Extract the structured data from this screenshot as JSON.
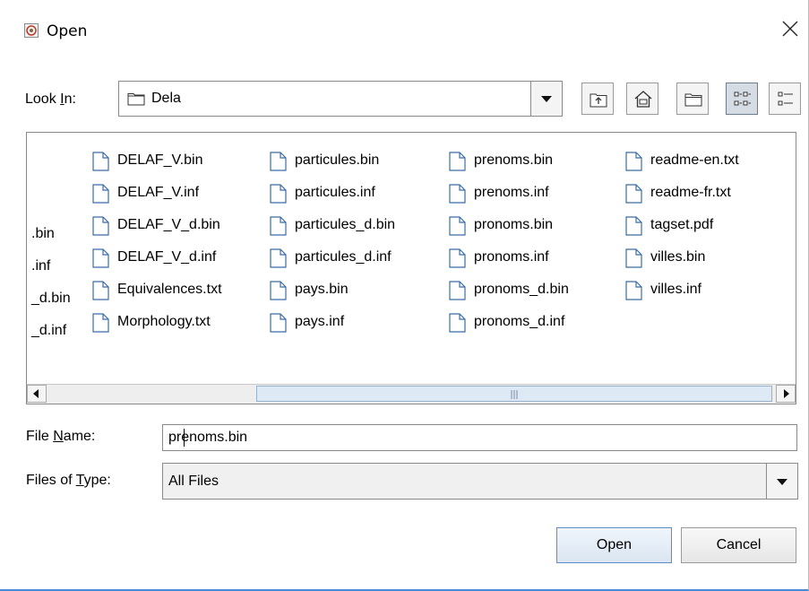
{
  "window": {
    "title": "Open"
  },
  "look_in": {
    "label_pre": "Look ",
    "label_u": "I",
    "label_post": "n:",
    "value": "Dela"
  },
  "toolbar": [
    "up-one-level-icon",
    "home-icon",
    "new-folder-icon",
    "list-view-icon",
    "details-view-icon"
  ],
  "cut_items": [
    ".bin",
    ".inf",
    "_d.bin",
    "_d.inf"
  ],
  "files": {
    "col1": [
      "DELAF_V.bin",
      "DELAF_V.inf",
      "DELAF_V_d.bin",
      "DELAF_V_d.inf",
      "Equivalences.txt",
      "Morphology.txt"
    ],
    "col2": [
      "particules.bin",
      "particules.inf",
      "particules_d.bin",
      "particules_d.inf",
      "pays.bin",
      "pays.inf"
    ],
    "col3": [
      "prenoms.bin",
      "prenoms.inf",
      "pronoms.bin",
      "pronoms.inf",
      "pronoms_d.bin",
      "pronoms_d.inf"
    ],
    "col4": [
      "readme-en.txt",
      "readme-fr.txt",
      "tagset.pdf",
      "villes.bin",
      "villes.inf"
    ]
  },
  "file_name": {
    "label_pre": "File ",
    "label_u": "N",
    "label_post": "ame:",
    "value": "prenoms.bin"
  },
  "file_type": {
    "label_pre": "Files of ",
    "label_u": "T",
    "label_post": "ype:",
    "value": "All Files"
  },
  "buttons": {
    "open": "Open",
    "cancel": "Cancel"
  },
  "colors": {
    "accent": "#4a8ad6",
    "selection": "#dde9f5"
  }
}
